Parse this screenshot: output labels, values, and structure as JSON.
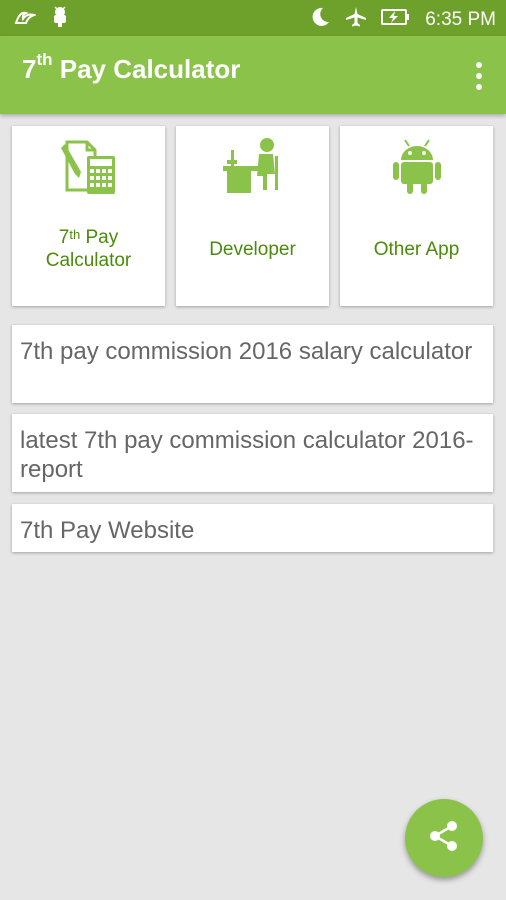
{
  "status_bar": {
    "time": "6:35 PM",
    "left_icons": [
      "bird-notification-icon",
      "android-debug-icon"
    ],
    "right_icons": [
      "moon-icon",
      "airplane-mode-icon",
      "battery-charging-icon"
    ]
  },
  "app_bar": {
    "title_prefix": "7",
    "title_sup": "th",
    "title_rest": " Pay Calculator",
    "menu_icon": "overflow-menu-icon",
    "color": "#8bc34a",
    "status_color": "#6ea12b"
  },
  "tiles": [
    {
      "icon": "calculator-document-icon",
      "label_prefix": "7",
      "label_sup": "th",
      "label_line1_rest": " Pay",
      "label_line2": "Calculator"
    },
    {
      "icon": "developer-desk-icon",
      "label": "Developer"
    },
    {
      "icon": "android-icon",
      "label": "Other App"
    }
  ],
  "links": [
    {
      "text": "7th pay commission 2016 salary calculator"
    },
    {
      "text": "latest 7th pay commission calculator 2016-report"
    },
    {
      "text": "7th Pay Website"
    }
  ],
  "fab": {
    "icon": "share-icon"
  },
  "colors": {
    "accent_text": "#4c8a0c",
    "icon_green": "#8bc34a",
    "background": "#e6e6e6"
  }
}
